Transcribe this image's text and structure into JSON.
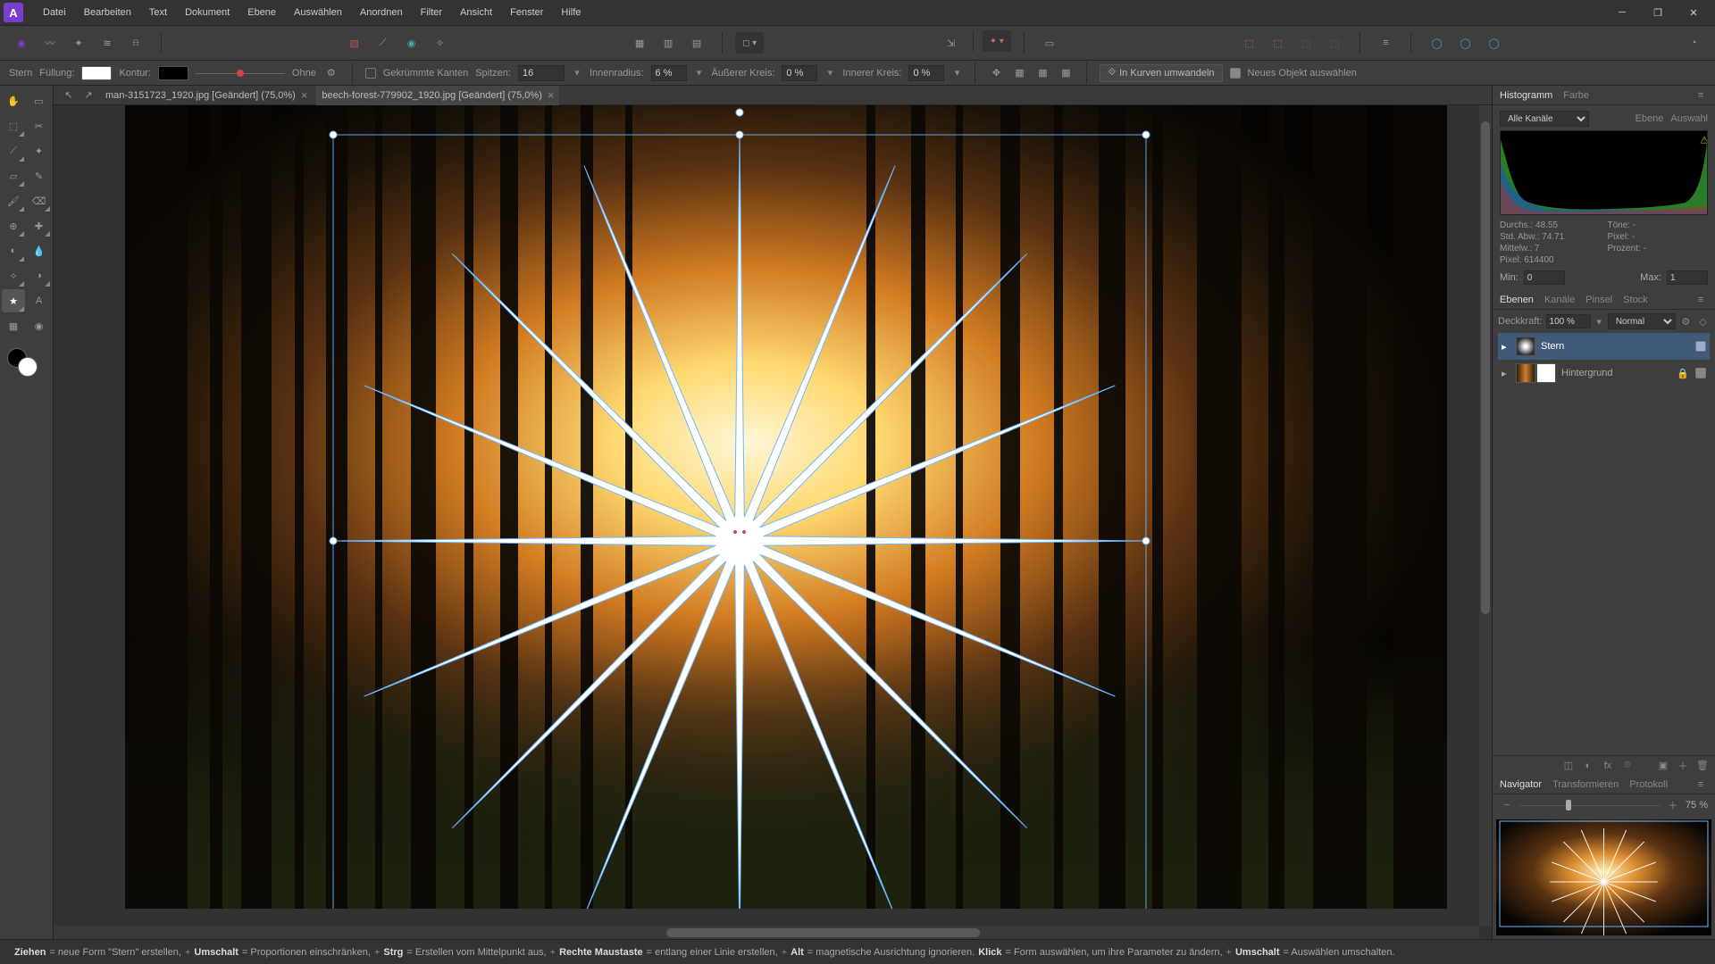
{
  "menu": [
    "Datei",
    "Bearbeiten",
    "Text",
    "Dokument",
    "Ebene",
    "Auswählen",
    "Anordnen",
    "Filter",
    "Ansicht",
    "Fenster",
    "Hilfe"
  ],
  "context": {
    "tool_name": "Stern",
    "fill_label": "Füllung:",
    "stroke_label": "Kontur:",
    "stroke_style": "Ohne",
    "curved_edges": "Gekrümmte Kanten",
    "points_label": "Spitzen:",
    "points_value": "16",
    "inner_radius_label": "Innenradius:",
    "inner_radius_value": "6 %",
    "outer_circle_label": "Äußerer Kreis:",
    "outer_circle_value": "0 %",
    "inner_circle_label": "Innerer Kreis:",
    "inner_circle_value": "0 %",
    "convert_curves": "In Kurven umwandeln",
    "new_object_select": "Neues Objekt auswählen"
  },
  "documents": [
    {
      "name": "man-3151723_1920.jpg [Geändert] (75,0%)",
      "active": false
    },
    {
      "name": "beech-forest-779902_1920.jpg [Geändert] (75,0%)",
      "active": true
    }
  ],
  "panels": {
    "hist_tabs": [
      "Histogramm",
      "Farbe"
    ],
    "hist_channel": "Alle Kanäle",
    "hist_sub": [
      "Ebene",
      "Auswahl"
    ],
    "stats": {
      "durchs_label": "Durchs.:",
      "durchs": "48.55",
      "stdabw_label": "Std. Abw.:",
      "stdabw": "74.71",
      "mittelw_label": "Mittelw.:",
      "mittelw": "7",
      "pixel_label": "Pixel:",
      "pixel": "614400",
      "toene_label": "Töne:",
      "toene": "-",
      "pixel2_label": "Pixel:",
      "pixel2": "-",
      "prozent_label": "Prozent:",
      "prozent": "-",
      "min_label": "Min:",
      "min": "0",
      "max_label": "Max:",
      "max": "1"
    },
    "layer_tabs": [
      "Ebenen",
      "Kanäle",
      "Pinsel",
      "Stock"
    ],
    "opacity_label": "Deckkraft:",
    "opacity_value": "100 %",
    "blend_mode": "Normal",
    "layers": [
      {
        "name": "Stern",
        "selected": true
      },
      {
        "name": "Hintergrund",
        "selected": false
      }
    ],
    "nav_tabs": [
      "Navigator",
      "Transformieren",
      "Protokoll"
    ],
    "zoom_value": "75 %"
  },
  "statusbar": {
    "ziehen": "Ziehen",
    "ziehen_txt": " = neue Form \"Stern\" erstellen, ",
    "p1": "+",
    "umschalt": "Umschalt",
    "umschalt_txt": " = Proportionen einschränken, ",
    "p2": "+",
    "strg": "Strg",
    "strg_txt": " = Erstellen vom Mittelpunkt aus, ",
    "p3": "+",
    "rmb": "Rechte Maustaste",
    "rmb_txt": " = entlang einer Linie erstellen, ",
    "p4": "+",
    "alt": "Alt",
    "alt_txt": " = magnetische Ausrichtung ignorieren. ",
    "klick": "Klick",
    "klick_txt": " = Form auswählen, um ihre Parameter zu ändern, ",
    "p5": "+",
    "umschalt2": "Umschalt",
    "umschalt2_txt": " = Auswählen umschalten."
  }
}
